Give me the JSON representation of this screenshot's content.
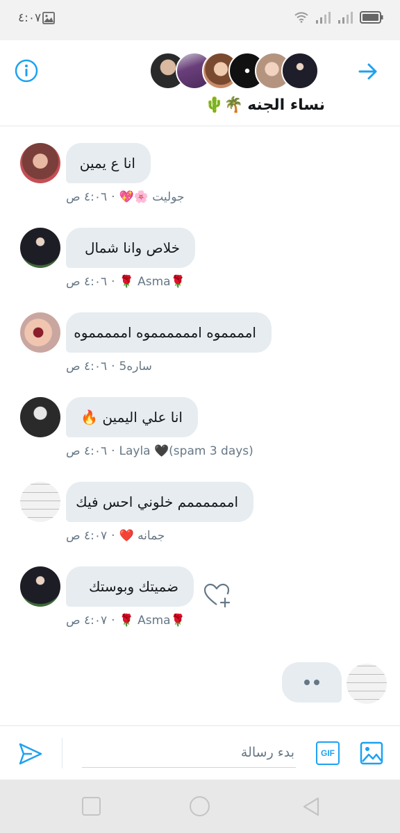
{
  "status_bar": {
    "time": "٤:٠٧"
  },
  "header": {
    "group_name": "نساء الجنه",
    "group_emoji": "🌵🌴"
  },
  "messages": [
    {
      "text": "انا ع يمين",
      "sender": "جوليت 🌸💖",
      "time": "٤:٠٦ ص"
    },
    {
      "text": "خلاص وانا  شمال",
      "sender": "🌹Asma 🌹",
      "time": "٤:٠٦ ص"
    },
    {
      "text": "امممموه امممممموه اممممموه",
      "sender": "ساره5",
      "time": "٤:٠٦ ص"
    },
    {
      "text": "انا علي اليمين 🔥",
      "sender": "Layla 🖤(spam 3 days)",
      "time": "٤:٠٦ ص"
    },
    {
      "text": "اممممممم خلوني احس فيك",
      "sender": "جمانه ❤️",
      "time": "٤:٠٧ ص"
    },
    {
      "text": "ضميتك  وبوستك",
      "sender": "🌹Asma 🌹",
      "time": "٤:٠٧ ص"
    }
  ],
  "composer": {
    "placeholder": "بدء رسالة",
    "gif_label": "GIF"
  },
  "colors": {
    "accent": "#1da1f2",
    "bubble": "#e6ecf0",
    "meta": "#657786"
  }
}
